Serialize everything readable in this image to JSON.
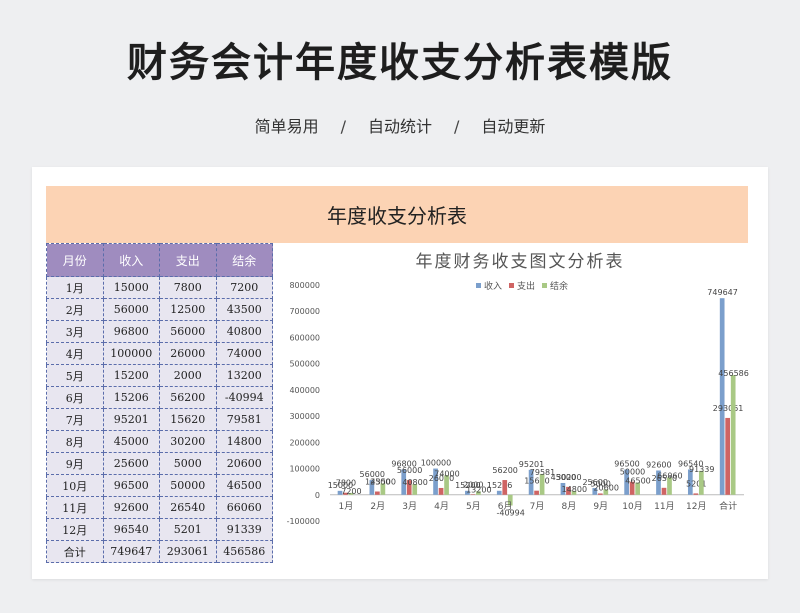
{
  "header": {
    "title": "财务会计年度收支分析表模版",
    "tags": [
      "简单易用",
      "自动统计",
      "自动更新"
    ],
    "separator": "/"
  },
  "sheet": {
    "banner_title": "年度收支分析表",
    "columns": [
      "月份",
      "收入",
      "支出",
      "结余"
    ],
    "rows": [
      [
        "1月",
        "15000",
        "7800",
        "7200"
      ],
      [
        "2月",
        "56000",
        "12500",
        "43500"
      ],
      [
        "3月",
        "96800",
        "56000",
        "40800"
      ],
      [
        "4月",
        "100000",
        "26000",
        "74000"
      ],
      [
        "5月",
        "15200",
        "2000",
        "13200"
      ],
      [
        "6月",
        "15206",
        "56200",
        "-40994"
      ],
      [
        "7月",
        "95201",
        "15620",
        "79581"
      ],
      [
        "8月",
        "45000",
        "30200",
        "14800"
      ],
      [
        "9月",
        "25600",
        "5000",
        "20600"
      ],
      [
        "10月",
        "96500",
        "50000",
        "46500"
      ],
      [
        "11月",
        "92600",
        "26540",
        "66060"
      ],
      [
        "12月",
        "96540",
        "5201",
        "91339"
      ]
    ],
    "total": [
      "合计",
      "749647",
      "293061",
      "456586"
    ],
    "colors": {
      "header_bg": "#9f8cbf",
      "cell_bg": "#e8e6f0",
      "banner_bg": "#fcd3b4",
      "border": "#5b6dab"
    }
  },
  "chart_data": {
    "type": "bar",
    "title": "年度财务收支图文分析表",
    "categories": [
      "1月",
      "2月",
      "3月",
      "4月",
      "5月",
      "6月",
      "7月",
      "8月",
      "9月",
      "10月",
      "11月",
      "12月",
      "合计"
    ],
    "series": [
      {
        "name": "收入",
        "color": "#7b9fcc",
        "values": [
          15000,
          56000,
          96800,
          100000,
          15200,
          15206,
          95201,
          45000,
          25600,
          96500,
          92600,
          96540,
          749647
        ]
      },
      {
        "name": "支出",
        "color": "#cf6463",
        "values": [
          7800,
          12500,
          56000,
          26000,
          2000,
          56200,
          15620,
          30200,
          5000,
          50000,
          26540,
          5201,
          293061
        ]
      },
      {
        "name": "结余",
        "color": "#a9c985",
        "values": [
          7200,
          43500,
          40800,
          74000,
          13200,
          -40994,
          79581,
          14800,
          20600,
          46500,
          66060,
          91339,
          456586
        ]
      }
    ],
    "yticks": [
      -100000,
      0,
      100000,
      200000,
      300000,
      400000,
      500000,
      600000,
      700000,
      800000
    ],
    "ylim": [
      -100000,
      800000
    ],
    "legend": "top-center",
    "grid": false,
    "data_labels": true
  }
}
